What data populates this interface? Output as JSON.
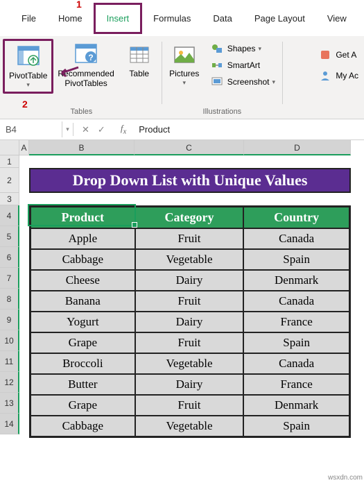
{
  "tabs": [
    "File",
    "Home",
    "Insert",
    "Formulas",
    "Data",
    "Page Layout",
    "View"
  ],
  "active_tab": "Insert",
  "annotations": {
    "step1": "1",
    "step2": "2"
  },
  "ribbon": {
    "pivottable": "PivotTable",
    "recommended": "Recommended\nPivotTables",
    "table": "Table",
    "pictures": "Pictures",
    "shapes": "Shapes",
    "smartart": "SmartArt",
    "screenshot": "Screenshot",
    "group_tables": "Tables",
    "group_illustrations": "Illustrations",
    "getaddins": "Get A",
    "myaddins": "My Ac"
  },
  "namebox": "B4",
  "formula": "Product",
  "col_headers": [
    "A",
    "B",
    "C",
    "D"
  ],
  "row_headers": [
    "1",
    "2",
    "3",
    "4",
    "5",
    "6",
    "7",
    "8",
    "9",
    "10",
    "11",
    "12",
    "13",
    "14"
  ],
  "row_heights": {
    "r1": 18,
    "r2": 36,
    "r3": 18,
    "rN": 30
  },
  "title": "Drop Down List with Unique Values",
  "table_headers": [
    "Product",
    "Category",
    "Country"
  ],
  "table_rows": [
    [
      "Apple",
      "Fruit",
      "Canada"
    ],
    [
      "Cabbage",
      "Vegetable",
      "Spain"
    ],
    [
      "Cheese",
      "Dairy",
      "Denmark"
    ],
    [
      "Banana",
      "Fruit",
      "Canada"
    ],
    [
      "Yogurt",
      "Dairy",
      "France"
    ],
    [
      "Grape",
      "Fruit",
      "Spain"
    ],
    [
      "Broccoli",
      "Vegetable",
      "Canada"
    ],
    [
      "Butter",
      "Dairy",
      "France"
    ],
    [
      "Grape",
      "Fruit",
      "Denmark"
    ],
    [
      "Cabbage",
      "Vegetable",
      "Spain"
    ]
  ],
  "watermark": "wsxdn.com"
}
